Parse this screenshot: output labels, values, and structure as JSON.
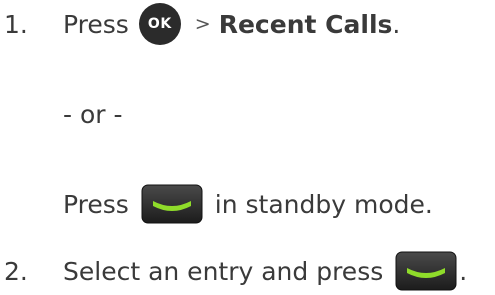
{
  "steps": [
    {
      "number": "1.",
      "press_label": "Press",
      "ok_key_label": "OK",
      "separator": ">",
      "target": "Recent Calls",
      "period": "."
    },
    {
      "number": "2.",
      "text": "Select an entry and press",
      "period": "."
    }
  ],
  "alternative": {
    "or_label": "- or -",
    "press_label": "Press",
    "suffix": "in standby mode."
  },
  "icons": {
    "ok_key": "ok-key-icon",
    "send_key": "send-key-icon"
  },
  "colors": {
    "text": "#3a3a3a",
    "ok_key_bg": "#2b2b2b",
    "send_key_green": "#8fdc2a"
  }
}
